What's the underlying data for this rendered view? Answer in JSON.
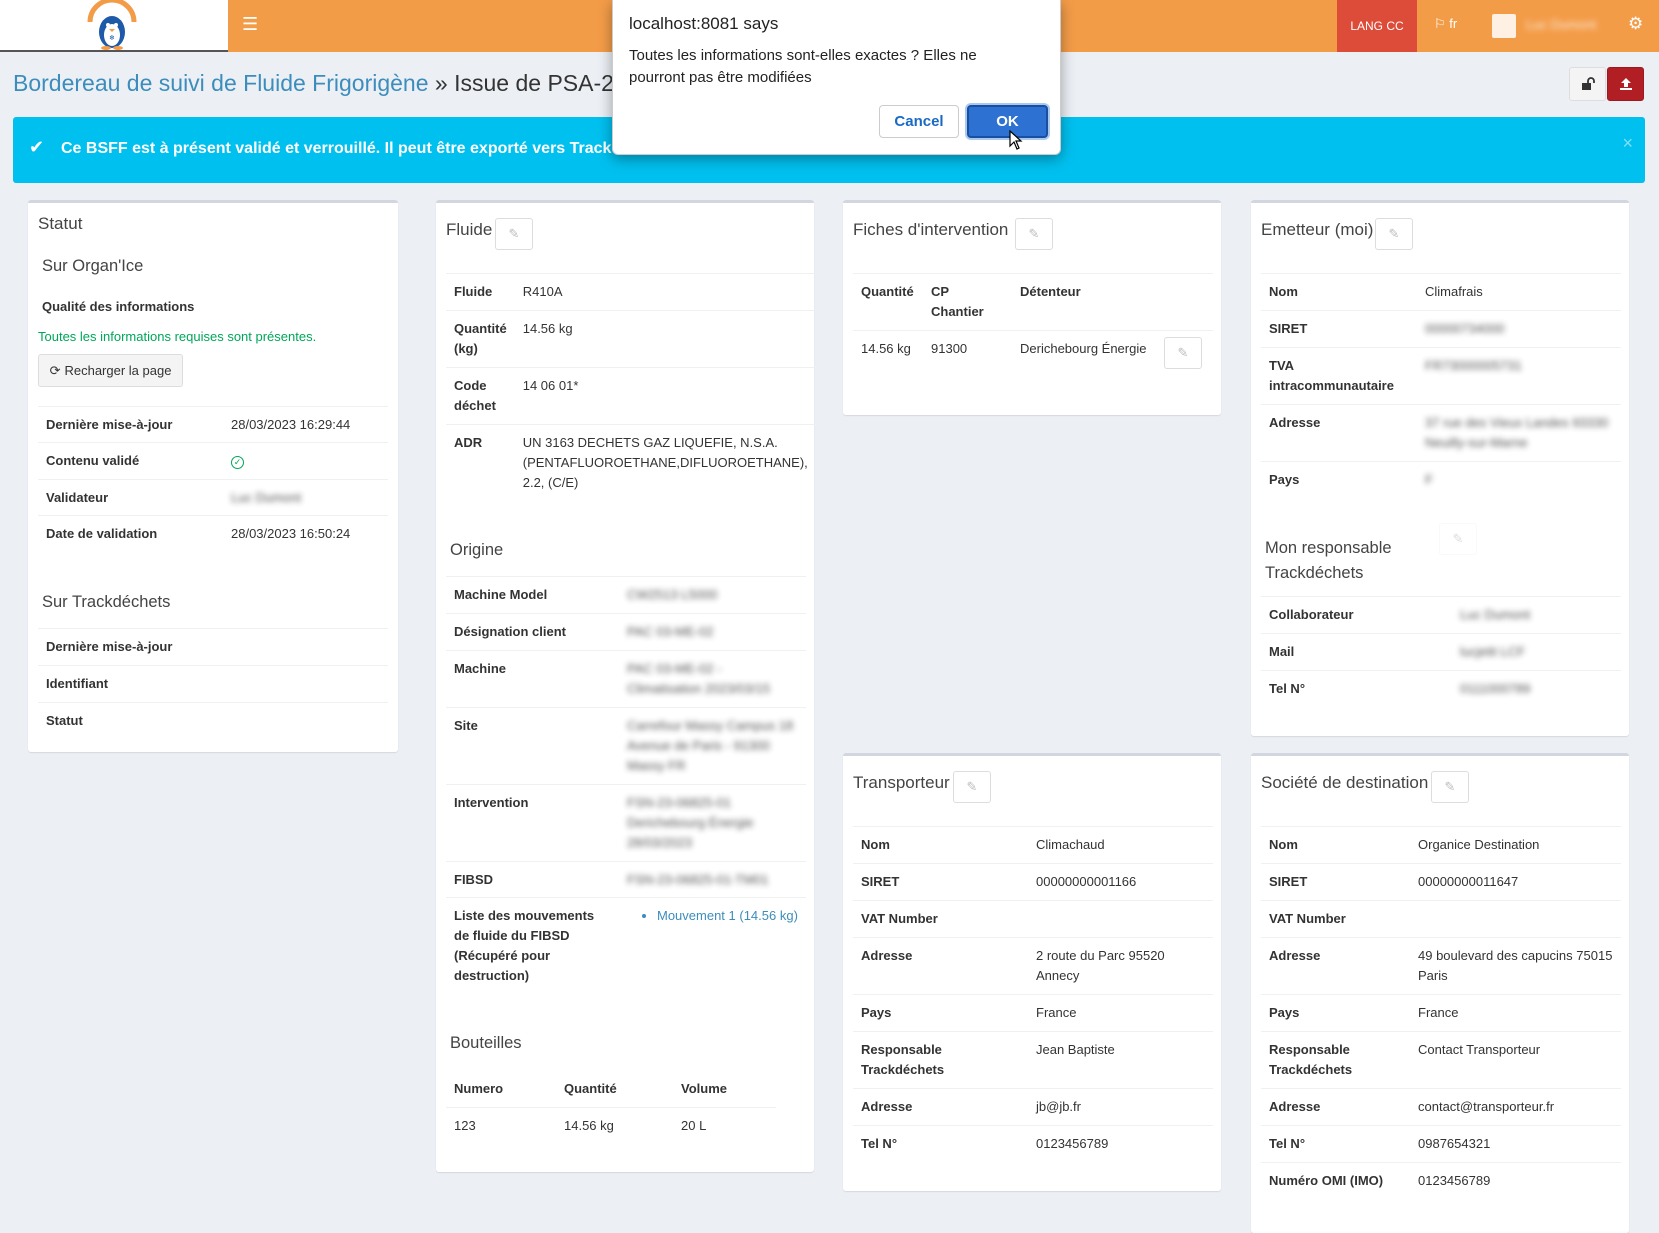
{
  "topbar": {
    "menu_icon": "hamburger-icon",
    "lang_button": "LANG CC",
    "language": "fr",
    "user_name": "Luc Dumont"
  },
  "header": {
    "breadcrumb": "Bordereau de suivi de Fluide Frigorigène",
    "separator": "»",
    "current": "Issue de PSA-23-0"
  },
  "alert": {
    "text": "Ce BSFF est à présent validé et verrouillé. Il peut être exporté vers Track",
    "close": "×"
  },
  "dialog": {
    "title": "localhost:8081 says",
    "message": "Toutes les informations sont-elles exactes ? Elles ne pourront pas être modifiées",
    "cancel": "Cancel",
    "ok": "OK"
  },
  "statut": {
    "title": "Statut",
    "organice_title": "Sur Organ'Ice",
    "quality_label": "Qualité des informations",
    "quality_msg": "Toutes les informations requises sont présentes.",
    "reload": "Recharger la page",
    "rows": [
      {
        "label": "Dernière mise-à-jour",
        "value": "28/03/2023 16:29:44"
      },
      {
        "label": "Contenu validé",
        "value": ""
      },
      {
        "label": "Validateur",
        "value": "Luc Dumont"
      },
      {
        "label": "Date de validation",
        "value": "28/03/2023 16:50:24"
      }
    ],
    "track_title": "Sur Trackdéchets",
    "track_rows": [
      {
        "label": "Dernière mise-à-jour",
        "value": ""
      },
      {
        "label": "Identifiant",
        "value": ""
      },
      {
        "label": "Statut",
        "value": ""
      }
    ]
  },
  "fluide": {
    "title": "Fluide",
    "rows": [
      {
        "label": "Fluide",
        "value": "R410A"
      },
      {
        "label": "Quantité (kg)",
        "value": "14.56 kg"
      },
      {
        "label": "Code déchet",
        "value": "14 06 01*"
      },
      {
        "label": "ADR",
        "value": "UN 3163 DECHETS GAZ LIQUEFIE, N.S.A. (PENTAFLUOROETHANE,DIFLUOROETHANE), 2.2, (C/E)"
      }
    ],
    "origine_title": "Origine",
    "origine_rows": [
      {
        "label": "Machine Model",
        "value": "CW2513 L5000"
      },
      {
        "label": "Désignation client",
        "value": "PAC 03-ME-02"
      },
      {
        "label": "Machine",
        "value": "PAC 03-ME-02 - Climatisation 2023/03/15"
      },
      {
        "label": "Site",
        "value": "Carrefour Massy Campus 18 Avenue de Paris - 91300 Massy FR"
      },
      {
        "label": "Intervention",
        "value": "FSN-23-06825-01 Derichebourg Énergie 28/03/2023"
      },
      {
        "label": "FIBSD",
        "value": "FSN-23-06825-01-TM01"
      },
      {
        "label": "Liste des mouvements de fluide du FIBSD (Récupéré pour destruction)",
        "value": "Mouvement 1 (14.56 kg)"
      }
    ],
    "bouteilles_title": "Bouteilles",
    "bouteilles_headers": [
      "Numero",
      "Quantité",
      "Volume"
    ],
    "bouteilles_rows": [
      [
        "123",
        "14.56 kg",
        "20 L"
      ]
    ]
  },
  "fiches": {
    "title": "Fiches d'intervention",
    "headers": [
      "Quantité",
      "CP Chantier",
      "Détenteur"
    ],
    "rows": [
      [
        "14.56 kg",
        "91300",
        "Derichebourg Énergie"
      ]
    ]
  },
  "emetteur": {
    "title": "Emetteur (moi)",
    "rows": [
      {
        "label": "Nom",
        "value": "Climafrais"
      },
      {
        "label": "SIRET",
        "value": "00000734000"
      },
      {
        "label": "TVA intracommunautaire",
        "value": "FR73000005731"
      },
      {
        "label": "Adresse",
        "value": "37 rue des Vieux Landes 93330 Neuilly-sur-Marne"
      },
      {
        "label": "Pays",
        "value": "F"
      }
    ],
    "resp_title": "Mon responsable Trackdéchets",
    "resp_rows": [
      {
        "label": "Collaborateur",
        "value": "Luc Dumont"
      },
      {
        "label": "Mail",
        "value": "lucjetit LCF"
      },
      {
        "label": "Tel N°",
        "value": "0111000789"
      }
    ]
  },
  "transporteur": {
    "title": "Transporteur",
    "rows": [
      {
        "label": "Nom",
        "value": "Climachaud"
      },
      {
        "label": "SIRET",
        "value": "00000000001166"
      },
      {
        "label": "VAT Number",
        "value": ""
      },
      {
        "label": "Adresse",
        "value": "2 route du Parc 95520 Annecy"
      },
      {
        "label": "Pays",
        "value": "France"
      },
      {
        "label": "Responsable Trackdéchets",
        "value": "Jean Baptiste"
      },
      {
        "label": "Adresse",
        "value": "jb@jb.fr"
      },
      {
        "label": "Tel N°",
        "value": "0123456789"
      }
    ]
  },
  "destination": {
    "title": "Société de destination",
    "rows": [
      {
        "label": "Nom",
        "value": "Organice Destination"
      },
      {
        "label": "SIRET",
        "value": "00000000011647"
      },
      {
        "label": "VAT Number",
        "value": ""
      },
      {
        "label": "Adresse",
        "value": "49 boulevard des capucins 75015 Paris"
      },
      {
        "label": "Pays",
        "value": "France"
      },
      {
        "label": "Responsable Trackdéchets",
        "value": "Contact Transporteur"
      },
      {
        "label": "Adresse",
        "value": "contact@transporteur.fr"
      },
      {
        "label": "Tel N°",
        "value": "0987654321"
      },
      {
        "label": "Numéro OMI (IMO)",
        "value": "0123456789"
      }
    ]
  },
  "colors": {
    "topbar": "#f39c48",
    "alert": "#00c0ef",
    "link": "#3c8dbc",
    "danger": "#dd4b39",
    "export": "#b11f24",
    "success": "#00a65a"
  }
}
